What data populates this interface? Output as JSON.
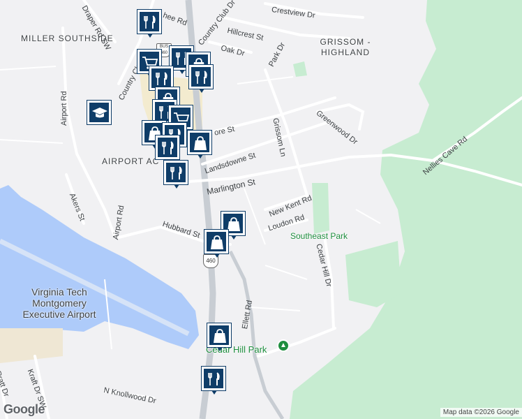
{
  "map": {
    "areas": [
      "MILLER SOUTHSIDE",
      "GRISSOM - HIGHLAND",
      "AIRPORT AC"
    ],
    "airport_name": "Virginia Tech Montgomery Executive Airport",
    "parks": [
      "Southeast Park",
      "Cedar Hill Park"
    ],
    "roads": [
      "Draper Rd SW",
      "Country Club Dr",
      "Country Club Dr SE",
      "Crestview Dr",
      "Hillcrest St",
      "Oak Dr",
      "Park Dr",
      "Airport Rd",
      "Greenwood Dr",
      "Grissom Ln",
      "Nellies Cave Rd",
      "Landsdowne St",
      "Marlington St",
      "New Kent Rd",
      "Loudon Rd",
      "Cedar Hill Dr",
      "Hubbard St",
      "Akers St",
      "Ellett Rd",
      "N Knollwood Dr",
      "Kraft Dr SW",
      "Pratt Dr",
      "hee Rd",
      "ore St"
    ],
    "route_shields": [
      "460",
      "BUS 460"
    ],
    "poi_marker_types": [
      "restaurant",
      "shopping-cart",
      "shopping-bag",
      "school"
    ],
    "colors": {
      "background": "#f1f1f3",
      "water": "#aecbfa",
      "green_area": "#c7ecd1",
      "highway": "#c8cdd3",
      "marker": "#0f3d68",
      "park_text": "#1e8e3e"
    }
  },
  "branding": {
    "logo": "Google"
  },
  "attribution": "Map data ©2026 Google"
}
